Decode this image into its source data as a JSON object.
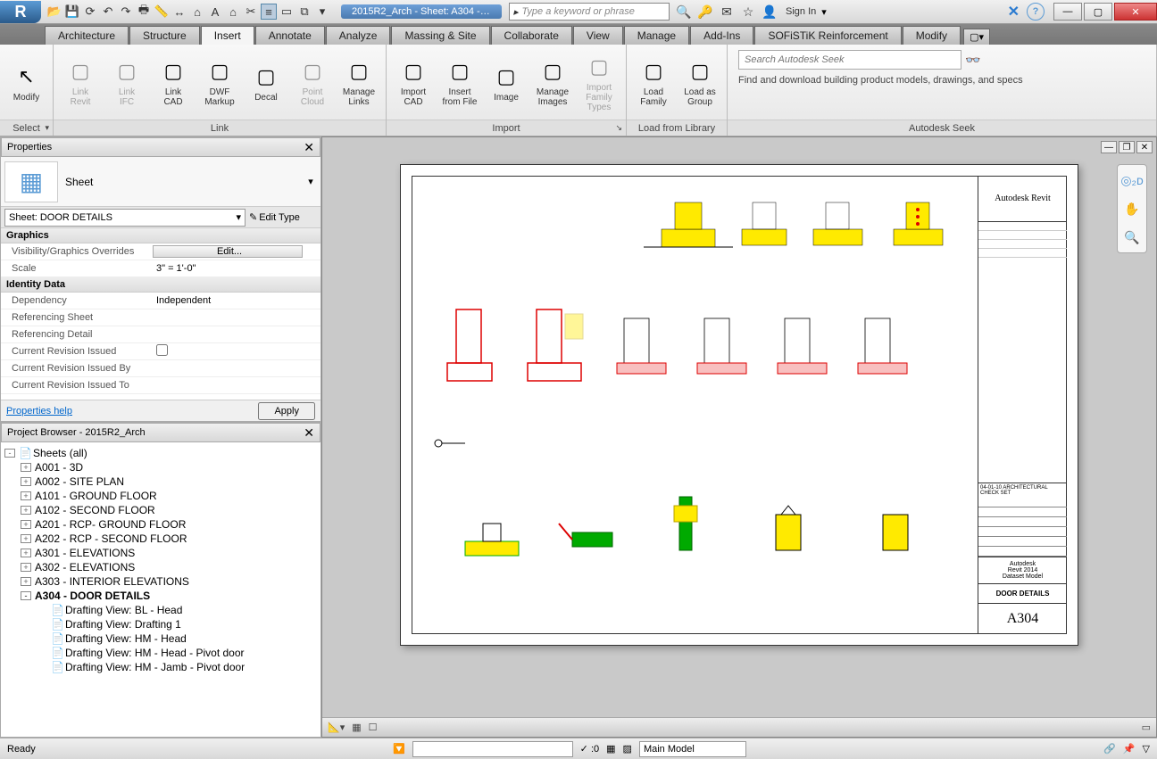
{
  "app_title": "2015R2_Arch - Sheet: A304 - D...",
  "search_placeholder": "Type a keyword or phrase",
  "signin_label": "Sign In",
  "ribbon_tabs": [
    "Architecture",
    "Structure",
    "Insert",
    "Annotate",
    "Analyze",
    "Massing & Site",
    "Collaborate",
    "View",
    "Manage",
    "Add-Ins",
    "SOFiSTiK Reinforcement",
    "Modify"
  ],
  "active_tab_index": 2,
  "ribbon": {
    "select": {
      "modify": "Modify",
      "select": "Select"
    },
    "link": {
      "title": "Link",
      "buttons": [
        {
          "label": "Link\nRevit",
          "disabled": true
        },
        {
          "label": "Link\nIFC",
          "disabled": true
        },
        {
          "label": "Link\nCAD",
          "disabled": false
        },
        {
          "label": "DWF\nMarkup",
          "disabled": false
        },
        {
          "label": "Decal",
          "disabled": false
        },
        {
          "label": "Point\nCloud",
          "disabled": true
        },
        {
          "label": "Manage\nLinks",
          "disabled": false
        }
      ]
    },
    "import": {
      "title": "Import",
      "buttons": [
        {
          "label": "Import\nCAD",
          "disabled": false
        },
        {
          "label": "Insert\nfrom File",
          "disabled": false
        },
        {
          "label": "Image",
          "disabled": false
        },
        {
          "label": "Manage\nImages",
          "disabled": false
        },
        {
          "label": "Import\nFamily Types",
          "disabled": true
        }
      ]
    },
    "load": {
      "title": "Load from Library",
      "buttons": [
        {
          "label": "Load\nFamily",
          "disabled": false
        },
        {
          "label": "Load as\nGroup",
          "disabled": false
        }
      ]
    },
    "seek": {
      "title": "Autodesk Seek",
      "placeholder": "Search Autodesk Seek",
      "desc": "Find and download building product models, drawings, and specs"
    }
  },
  "properties": {
    "panel_title": "Properties",
    "type_name": "Sheet",
    "instance_selector": "Sheet: DOOR DETAILS",
    "edit_type": "Edit Type",
    "help": "Properties help",
    "apply": "Apply",
    "groups": [
      {
        "cat": "Graphics",
        "rows": [
          {
            "k": "Visibility/Graphics Overrides",
            "v": "Edit...",
            "btn": true
          },
          {
            "k": "Scale",
            "v": "3\" = 1'-0\""
          }
        ]
      },
      {
        "cat": "Identity Data",
        "rows": [
          {
            "k": "Dependency",
            "v": "Independent"
          },
          {
            "k": "Referencing Sheet",
            "v": ""
          },
          {
            "k": "Referencing Detail",
            "v": ""
          },
          {
            "k": "Current Revision Issued",
            "v": "",
            "check": true
          },
          {
            "k": "Current Revision Issued By",
            "v": ""
          },
          {
            "k": "Current Revision Issued To",
            "v": ""
          }
        ]
      }
    ]
  },
  "browser": {
    "panel_title": "Project Browser - 2015R2_Arch",
    "root": "Sheets (all)",
    "sheets": [
      "A001 - 3D",
      "A002 - SITE PLAN",
      "A101 - GROUND FLOOR",
      "A102 - SECOND FLOOR",
      "A201 - RCP- GROUND FLOOR",
      "A202 - RCP - SECOND FLOOR",
      "A301 - ELEVATIONS",
      "A302 - ELEVATIONS",
      "A303 - INTERIOR ELEVATIONS"
    ],
    "active_sheet": "A304 - DOOR DETAILS",
    "drafting_views": [
      "Drafting View: BL - Head",
      "Drafting View: Drafting 1",
      "Drafting View: HM - Head",
      "Drafting View: HM - Head - Pivot door",
      "Drafting View: HM - Jamb - Pivot door"
    ]
  },
  "titleblock": {
    "brand": "Autodesk Revit",
    "project1": "Autodesk",
    "project2": "Revit 2014",
    "project3": "Dataset Model",
    "sheet_name": "DOOR DETAILS",
    "sheet_number": "A304",
    "checkset": "04-01-10 ARCHITECTURAL CHECK SET"
  },
  "statusbar": {
    "ready": "Ready",
    "press_drag": ":0",
    "workset": "Main Model"
  }
}
